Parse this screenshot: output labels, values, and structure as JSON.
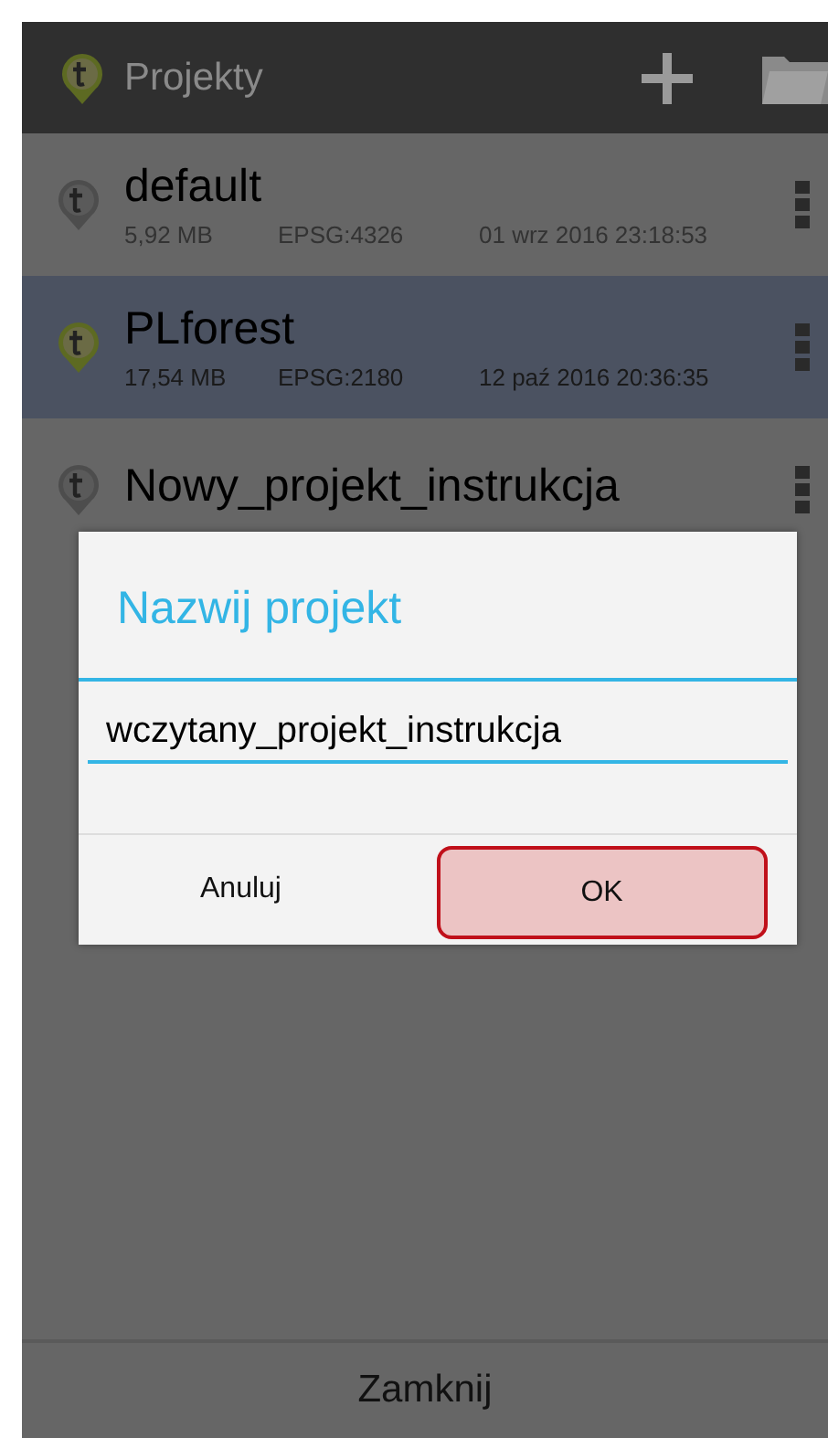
{
  "header": {
    "title": "Projekty"
  },
  "projects": [
    {
      "name": "default",
      "size": "5,92 MB",
      "epsg": "EPSG:4326",
      "date": "01 wrz 2016 23:18:53",
      "selected": false
    },
    {
      "name": "PLforest",
      "size": "17,54 MB",
      "epsg": "EPSG:2180",
      "date": "12 paź 2016 20:36:35",
      "selected": true
    },
    {
      "name": "Nowy_projekt_instrukcja",
      "selected": false
    }
  ],
  "dialog": {
    "title": "Nazwij projekt",
    "value": "wczytany_projekt_instrukcja",
    "buttons": [
      {
        "label": "Anuluj",
        "highlighted": false
      },
      {
        "label": "OK",
        "highlighted": true
      }
    ]
  },
  "footer": {
    "label": "Zamknij"
  }
}
